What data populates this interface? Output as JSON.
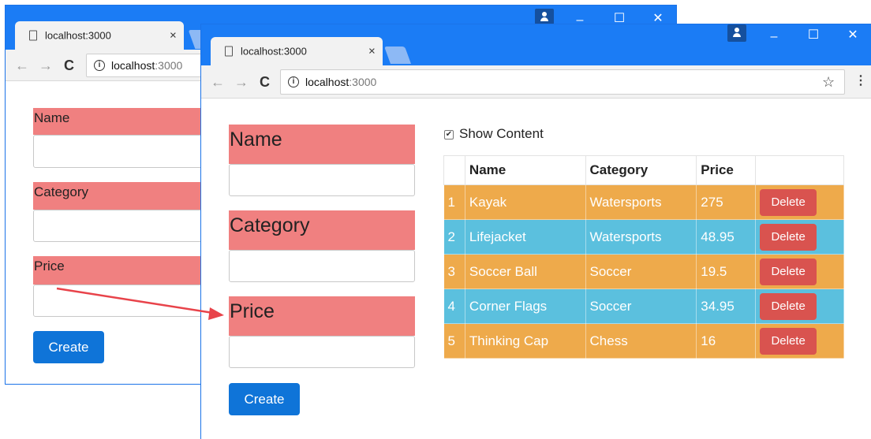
{
  "back_window": {
    "tab": {
      "title": "localhost:3000",
      "close": "×"
    },
    "address": {
      "host": "localhost",
      "port": ":3000",
      "info": "i"
    },
    "nav": {
      "back": "←",
      "forward": "→",
      "reload": "C"
    },
    "controls": {
      "minimize": "–",
      "maximize": "☐",
      "close": "✕"
    },
    "form": {
      "name_label": "Name",
      "category_label": "Category",
      "price_label": "Price",
      "create_label": "Create"
    }
  },
  "front_window": {
    "tab": {
      "title": "localhost:3000",
      "close": "×"
    },
    "address": {
      "host": "localhost",
      "port": ":3000",
      "info": "i"
    },
    "nav": {
      "back": "←",
      "forward": "→",
      "reload": "C"
    },
    "controls": {
      "minimize": "–",
      "maximize": "☐",
      "close": "✕"
    },
    "bookmark_icon": "☆",
    "menu_icon": "⋮",
    "form": {
      "name_label": "Name",
      "category_label": "Category",
      "price_label": "Price",
      "create_label": "Create"
    },
    "show_content": {
      "label": "Show Content",
      "checked": true,
      "mark": "✔"
    },
    "table": {
      "headers": [
        "",
        "Name",
        "Category",
        "Price",
        ""
      ],
      "rows": [
        {
          "index": "1",
          "name": "Kayak",
          "category": "Watersports",
          "price": "275",
          "action": "Delete",
          "style": "warn"
        },
        {
          "index": "2",
          "name": "Lifejacket",
          "category": "Watersports",
          "price": "48.95",
          "action": "Delete",
          "style": "info"
        },
        {
          "index": "3",
          "name": "Soccer Ball",
          "category": "Soccer",
          "price": "19.5",
          "action": "Delete",
          "style": "warn"
        },
        {
          "index": "4",
          "name": "Corner Flags",
          "category": "Soccer",
          "price": "34.95",
          "action": "Delete",
          "style": "info"
        },
        {
          "index": "5",
          "name": "Thinking Cap",
          "category": "Chess",
          "price": "16",
          "action": "Delete",
          "style": "warn"
        }
      ]
    }
  },
  "colors": {
    "titlebar": "#1b7cf5",
    "label_background": "#f08080",
    "primary_button": "#0f74d8",
    "danger_button": "#d9534f",
    "row_warning": "#eeaa4b",
    "row_info": "#5bc0de",
    "arrow": "#e8434a"
  }
}
